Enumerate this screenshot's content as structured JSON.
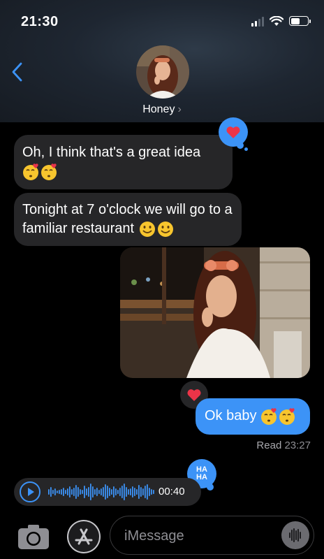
{
  "status_bar": {
    "time": "21:30"
  },
  "header": {
    "contact_name": "Honey"
  },
  "messages": [
    {
      "direction": "received",
      "text": "Oh, I think that's a great idea"
    },
    {
      "direction": "received",
      "text": "Tonight at 7 o'clock we will go to a familiar restaurant"
    },
    {
      "direction": "received",
      "type": "photo"
    },
    {
      "direction": "sent",
      "text": "Ok baby"
    },
    {
      "direction": "received",
      "type": "audio",
      "duration": "00:40"
    }
  ],
  "receipt": {
    "label": "Read",
    "time": "23:27"
  },
  "tapbacks": {
    "haha_top": "HA",
    "haha_bottom": "HA"
  },
  "composer": {
    "placeholder": "iMessage"
  },
  "colors": {
    "sent_bubble": "#3c93f7",
    "received_bubble": "#262628",
    "heart": "#ec3448",
    "accent": "#3c93f7"
  },
  "icons": [
    "back-chevron-icon",
    "camera-icon",
    "app-store-icon",
    "microphone-waveform-icon",
    "play-icon",
    "heart-icon",
    "haha-icon",
    "kiss-emoji",
    "smile-emoji"
  ]
}
